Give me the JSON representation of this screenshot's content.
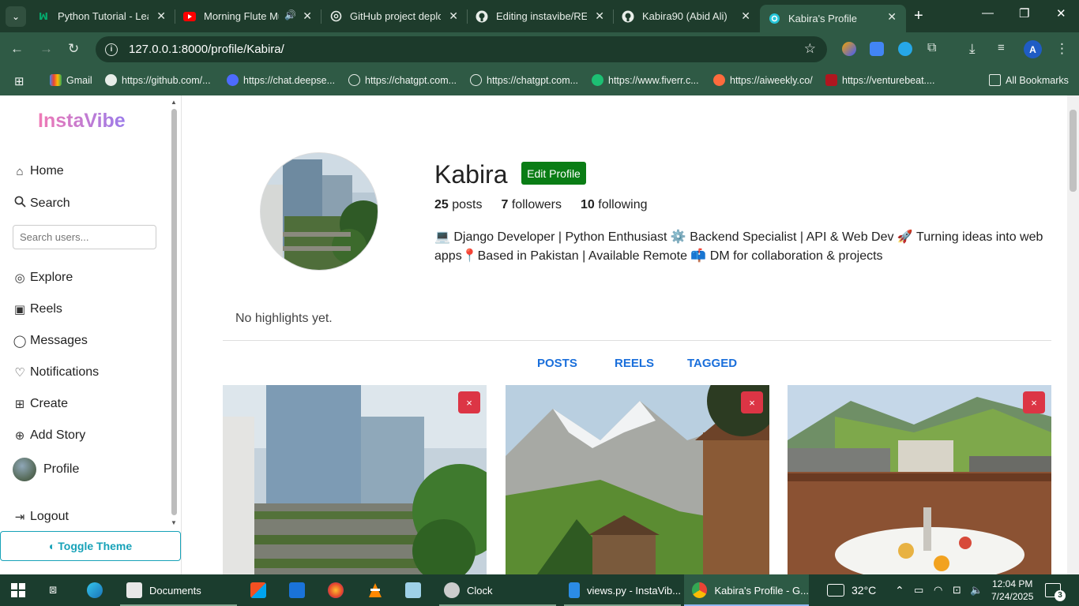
{
  "browser": {
    "tabs": [
      {
        "label": "Python Tutorial - Lear",
        "icon": "w3schools-icon"
      },
      {
        "label": "Morning Flute Mu",
        "icon": "youtube-icon"
      },
      {
        "label": "GitHub project deplo",
        "icon": "chatgpt-icon"
      },
      {
        "label": "Editing instavibe/REA",
        "icon": "github-icon"
      },
      {
        "label": "Kabira90 (Abid Ali)",
        "icon": "github-icon"
      },
      {
        "label": "Kabira's Profile",
        "icon": "instavibe-icon"
      }
    ],
    "url": "127.0.0.1:8000/profile/Kabira/",
    "profile_initial": "A",
    "bookmarks": [
      {
        "label": "Gmail"
      },
      {
        "label": "https://github.com/..."
      },
      {
        "label": "https://chat.deepse..."
      },
      {
        "label": "https://chatgpt.com..."
      },
      {
        "label": "https://chatgpt.com..."
      },
      {
        "label": "https://www.fiverr.c..."
      },
      {
        "label": "https://aiweekly.co/"
      },
      {
        "label": "https://venturebeat...."
      }
    ],
    "all_bookmarks": "All Bookmarks"
  },
  "sidebar": {
    "logo": "InstaVibe",
    "items": [
      {
        "label": "Home",
        "icon": "home-icon"
      },
      {
        "label": "Search",
        "icon": "search-icon"
      },
      {
        "label": "Explore",
        "icon": "compass-icon"
      },
      {
        "label": "Reels",
        "icon": "reels-icon"
      },
      {
        "label": "Messages",
        "icon": "chat-icon"
      },
      {
        "label": "Notifications",
        "icon": "heart-icon"
      },
      {
        "label": "Create",
        "icon": "plus-square-icon"
      },
      {
        "label": "Add Story",
        "icon": "plus-circle-icon"
      },
      {
        "label": "Profile",
        "icon": "avatar"
      },
      {
        "label": "Logout",
        "icon": "logout-icon"
      }
    ],
    "search_placeholder": "Search users...",
    "toggle_theme": "Toggle Theme"
  },
  "profile": {
    "username": "Kabira",
    "edit_label": "Edit Profile",
    "posts_count": "25",
    "posts_label": "posts",
    "followers_count": "7",
    "followers_label": "followers",
    "following_count": "10",
    "following_label": "following",
    "bio": "💻 Django Developer | Python Enthusiast ⚙️ Backend Specialist | API & Web Dev 🚀 Turning ideas into web apps📍Based in Pakistan | Available Remote 📫 DM for collaboration & projects",
    "highlights_empty": "No highlights yet.",
    "tabs": [
      "POSTS",
      "REELS",
      "TAGGED"
    ],
    "delete_label": "×"
  },
  "taskbar": {
    "items": [
      "Documents",
      "Clock",
      "views.py - InstaVib...",
      "Kabira's Profile - G..."
    ],
    "weather": "32°C",
    "time": "12:04 PM",
    "date": "7/24/2025",
    "notifications": "3"
  }
}
